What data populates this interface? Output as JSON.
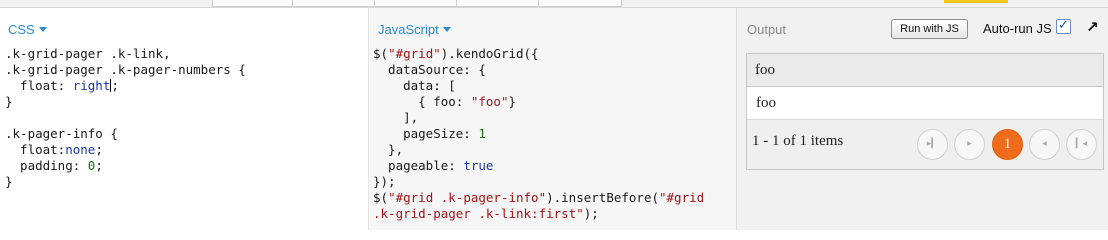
{
  "css_panel": {
    "label": "CSS",
    "code": [
      ".k-grid-pager .k-link,",
      ".k-grid-pager .k-pager-numbers {",
      "  float: right;",
      "}",
      "",
      ".k-pager-info {",
      "  float:none;",
      "  padding: 0;",
      "}"
    ]
  },
  "js_panel": {
    "label": "JavaScript",
    "code": [
      "$(\"#grid\").kendoGrid({",
      "  dataSource: {",
      "    data: [",
      "      { foo: \"foo\"}",
      "    ],",
      "    pageSize: 1",
      "  },",
      "  pageable: true",
      "});",
      "$(\"#grid .k-pager-info\").insertBefore(\"#grid",
      ".k-grid-pager .k-link:first\");"
    ]
  },
  "output_panel": {
    "label": "Output",
    "run_button": "Run with JS",
    "autorun_label": "Auto-run JS",
    "autorun_checked": true,
    "grid": {
      "column_header": "foo",
      "rows": [
        "foo"
      ],
      "pager_info": "1 - 1 of 1 items",
      "current_page": "1",
      "pager_buttons": [
        "first-page-icon",
        "previous-page-icon",
        "next-page-icon",
        "last-page-icon"
      ]
    }
  },
  "colors": {
    "accent": "#2a8ad4",
    "active_page": "#ef6c1c",
    "top_accent": "#f3c41a"
  }
}
